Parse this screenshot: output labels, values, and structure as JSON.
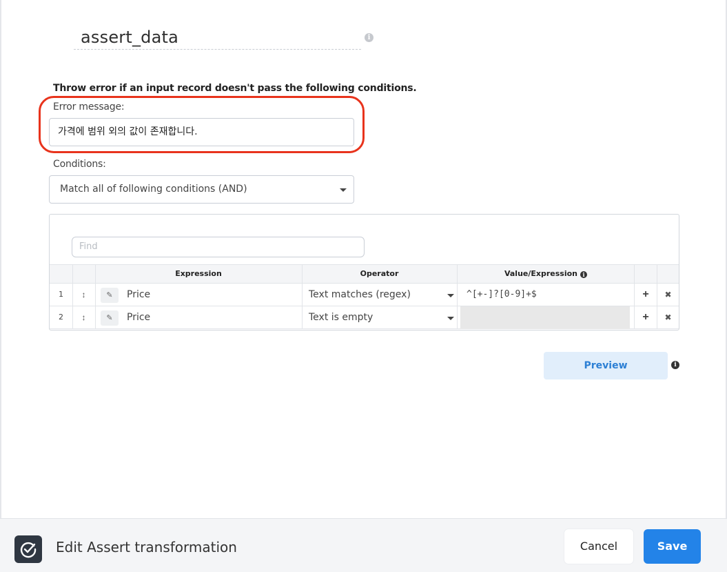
{
  "transform": {
    "name": "assert_data",
    "instruction": "Throw error if an input record doesn't pass the following conditions.",
    "error_label": "Error message:",
    "error_message": "가격에 범위 외의 값이 존재합니다.",
    "conditions_label": "Conditions:",
    "conditions_mode": "Match all of following conditions (AND)"
  },
  "table": {
    "find_placeholder": "Find",
    "headers": {
      "expression": "Expression",
      "operator": "Operator",
      "value": "Value/Expression"
    },
    "rows": [
      {
        "num": "1",
        "expression": "Price",
        "operator": "Text matches (regex)",
        "value": "^[+-]?[0-9]+$"
      },
      {
        "num": "2",
        "expression": "Price",
        "operator": "Text is empty",
        "value": ""
      }
    ]
  },
  "buttons": {
    "preview": "Preview",
    "cancel": "Cancel",
    "save": "Save"
  },
  "footer": {
    "title": "Edit Assert transformation"
  },
  "colors": {
    "highlight": "#e8331c",
    "primary": "#2383e8",
    "preview_bg": "#e1eefb"
  },
  "icons": {
    "info": "info-icon",
    "drag": "drag-handle-icon",
    "edit": "edit-icon",
    "add": "plus-icon",
    "remove": "close-icon",
    "transform": "check-circle-icon"
  }
}
